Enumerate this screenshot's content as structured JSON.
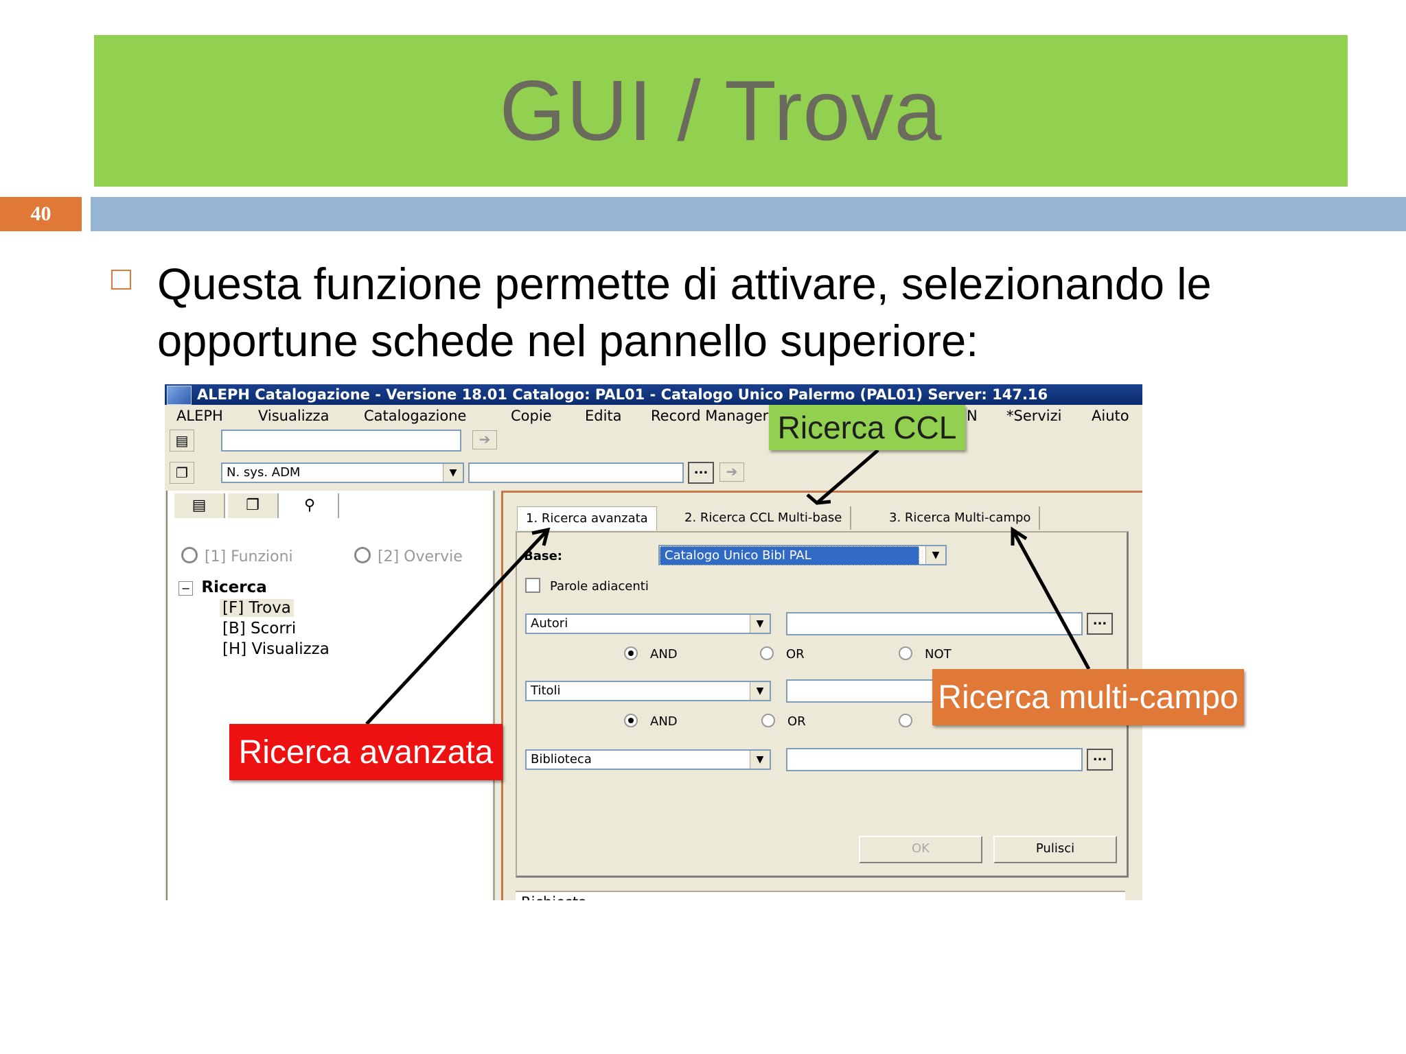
{
  "slide": {
    "title": "GUI / Trova",
    "number": "40",
    "bullet": "Questa funzione permette di attivare, selezionando le opportune schede nel pannello superiore:"
  },
  "window": {
    "title": "ALEPH Catalogazione - Versione 18.01  Catalogo:  PAL01 - Catalogo Unico Palermo (PAL01)  Server:  147.16",
    "menu": [
      "ALEPH",
      "Visualizza",
      "Catalogazione",
      "Copie",
      "Edita",
      "Record Manager",
      "N",
      "*Servizi",
      "Aiuto"
    ],
    "toolbar": {
      "search_value": "",
      "index_select": "N. sys. ADM",
      "index_value": "",
      "dots": "..."
    },
    "left_panel": {
      "radio1": "[1] Funzioni",
      "radio2": "[2] Overvie",
      "tree_root": "Ricerca",
      "tree_items": [
        "[F] Trova",
        "[B] Scorri",
        "[H] Visualizza"
      ]
    },
    "right_panel": {
      "tabs": [
        "1. Ricerca avanzata",
        "2. Ricerca CCL Multi-base",
        "3. Ricerca Multi-campo"
      ],
      "base_label": "Base:",
      "base_value": "Catalogo Unico Bibl PAL",
      "adjacent_label": "Parole adiacenti",
      "field1": "Autori",
      "field2": "Titoli",
      "field3": "Biblioteca",
      "ops1": [
        "AND",
        "OR",
        "NOT"
      ],
      "ops2": [
        "AND",
        "OR"
      ],
      "ok_button": "OK",
      "clear_button": "Pulisci",
      "request_label": "Richiesta"
    }
  },
  "callouts": {
    "ccl": "Ricerca CCL",
    "advanced": "Ricerca avanzata",
    "multi": "Ricerca multi-campo"
  }
}
